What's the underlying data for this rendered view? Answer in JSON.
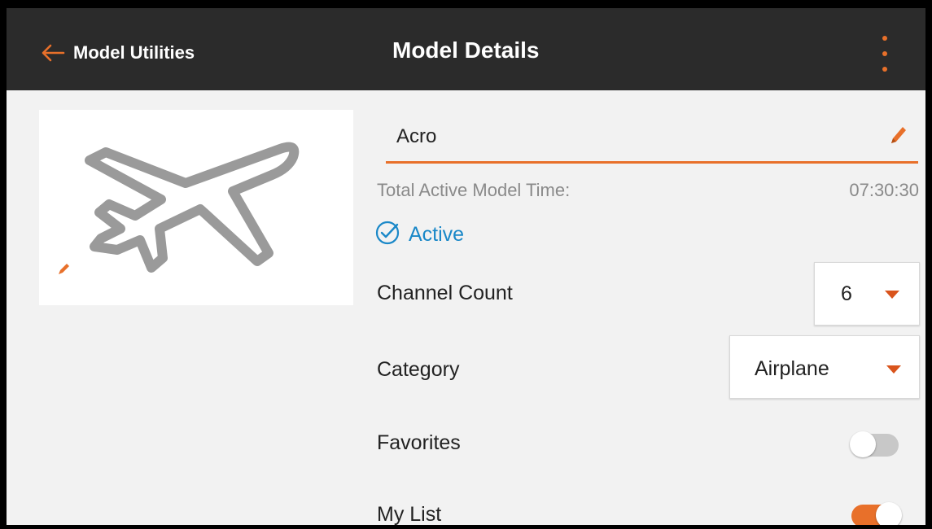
{
  "header": {
    "back_label": "Model Utilities",
    "title": "Model Details",
    "back_icon": "arrow-left-icon",
    "menu_icon": "more-vertical-icon"
  },
  "model": {
    "name": "Acro",
    "time_label": "Total Active Model Time:",
    "time_value": "07:30:30",
    "status_label": "Active"
  },
  "settings": {
    "channel_count_label": "Channel Count",
    "channel_count_value": "6",
    "category_label": "Category",
    "category_value": "Airplane",
    "favorites_label": "Favorites",
    "favorites_on": false,
    "mylist_label": "My List",
    "mylist_on": true
  },
  "colors": {
    "accent": "#e8702a",
    "active_blue": "#1a88c8",
    "header_bg": "#2b2b2b",
    "background": "#f2f2f2"
  }
}
